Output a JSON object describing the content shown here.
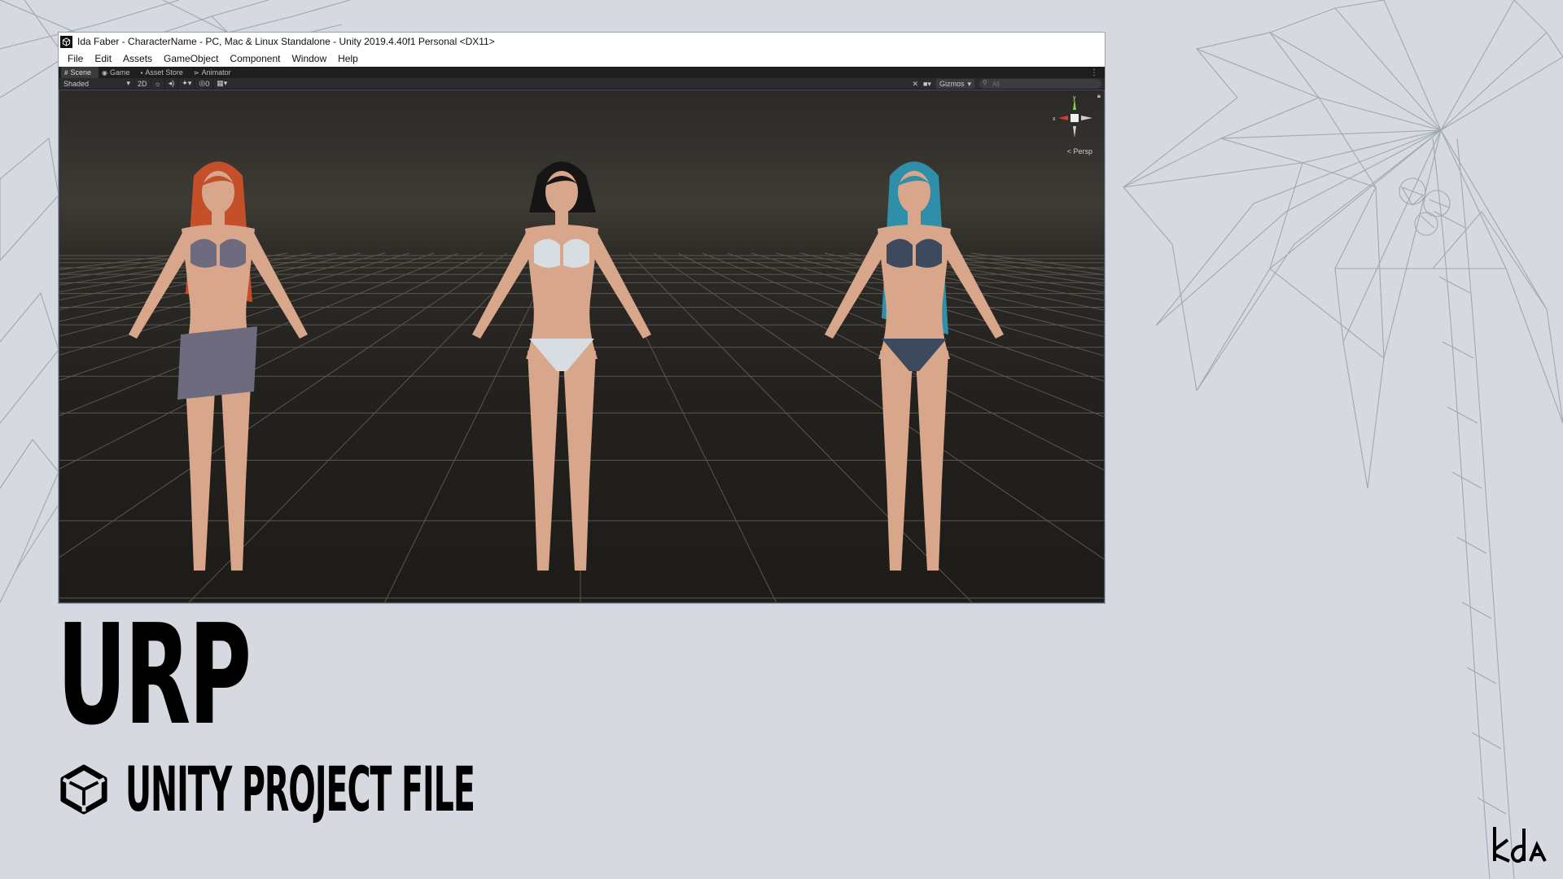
{
  "window": {
    "title": "Ida Faber - CharacterName - PC, Mac & Linux Standalone - Unity 2019.4.40f1 Personal <DX11>",
    "menu": [
      "File",
      "Edit",
      "Assets",
      "GameObject",
      "Component",
      "Window",
      "Help"
    ]
  },
  "tabs": [
    {
      "label": "Scene",
      "icon": "hash-icon",
      "active": true
    },
    {
      "label": "Game",
      "icon": "gamepad-icon",
      "active": false
    },
    {
      "label": "Asset Store",
      "icon": "bag-icon",
      "active": false
    },
    {
      "label": "Animator",
      "icon": "animator-icon",
      "active": false
    }
  ],
  "toolbar": {
    "shading_mode": "Shaded",
    "mode_2d": "2D",
    "hidden_count": "0",
    "gizmos_label": "Gizmos",
    "search_placeholder": "All"
  },
  "scene_gizmo": {
    "y_label": "y",
    "x_label": "x",
    "persp_label": "< Persp"
  },
  "characters": [
    {
      "hair_color": "#c4502a",
      "outfit_color": "#6f6b7e"
    },
    {
      "hair_color": "#151515",
      "outfit_color": "#d8dde2"
    },
    {
      "hair_color": "#2f8fa8",
      "outfit_color": "#3d4a5e"
    }
  ],
  "colors": {
    "page_background": "#d6dae0",
    "viewport_top": "#3e3b35",
    "viewport_floor": "#1e1c19",
    "skin": "#d8a68a"
  },
  "headline": "URP",
  "subtitle": "UNITY PROJECT FILE"
}
